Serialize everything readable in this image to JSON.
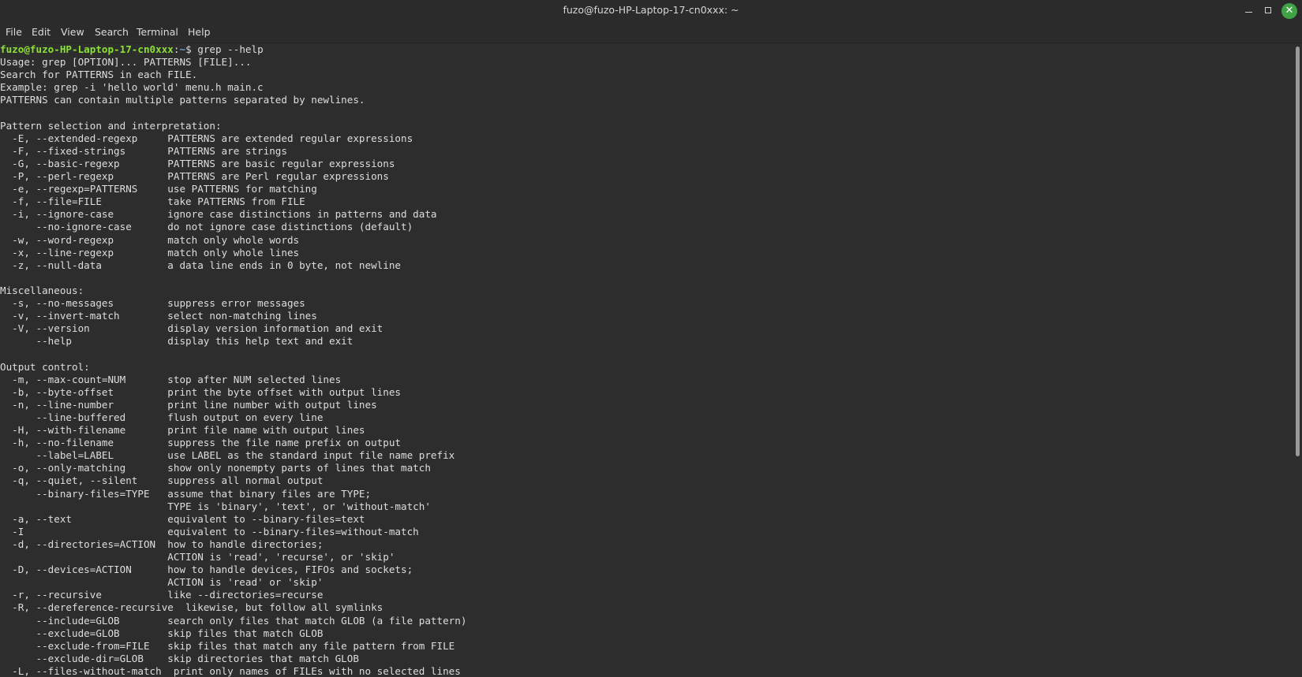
{
  "window": {
    "title": "fuzo@fuzo-HP-Laptop-17-cn0xxx: ~"
  },
  "menubar": {
    "items": [
      "File",
      "Edit",
      "View",
      "Search",
      "Terminal",
      "Help"
    ]
  },
  "terminal": {
    "prompt": {
      "user_host": "fuzo@fuzo-HP-Laptop-17-cn0xxx",
      "separator": ":",
      "path": "~",
      "symbol": "$ ",
      "command": "grep --help"
    },
    "lines": [
      "Usage: grep [OPTION]... PATTERNS [FILE]...",
      "Search for PATTERNS in each FILE.",
      "Example: grep -i 'hello world' menu.h main.c",
      "PATTERNS can contain multiple patterns separated by newlines.",
      "",
      "Pattern selection and interpretation:",
      "  -E, --extended-regexp     PATTERNS are extended regular expressions",
      "  -F, --fixed-strings       PATTERNS are strings",
      "  -G, --basic-regexp        PATTERNS are basic regular expressions",
      "  -P, --perl-regexp         PATTERNS are Perl regular expressions",
      "  -e, --regexp=PATTERNS     use PATTERNS for matching",
      "  -f, --file=FILE           take PATTERNS from FILE",
      "  -i, --ignore-case         ignore case distinctions in patterns and data",
      "      --no-ignore-case      do not ignore case distinctions (default)",
      "  -w, --word-regexp         match only whole words",
      "  -x, --line-regexp         match only whole lines",
      "  -z, --null-data           a data line ends in 0 byte, not newline",
      "",
      "Miscellaneous:",
      "  -s, --no-messages         suppress error messages",
      "  -v, --invert-match        select non-matching lines",
      "  -V, --version             display version information and exit",
      "      --help                display this help text and exit",
      "",
      "Output control:",
      "  -m, --max-count=NUM       stop after NUM selected lines",
      "  -b, --byte-offset         print the byte offset with output lines",
      "  -n, --line-number         print line number with output lines",
      "      --line-buffered       flush output on every line",
      "  -H, --with-filename       print file name with output lines",
      "  -h, --no-filename         suppress the file name prefix on output",
      "      --label=LABEL         use LABEL as the standard input file name prefix",
      "  -o, --only-matching       show only nonempty parts of lines that match",
      "  -q, --quiet, --silent     suppress all normal output",
      "      --binary-files=TYPE   assume that binary files are TYPE;",
      "                            TYPE is 'binary', 'text', or 'without-match'",
      "  -a, --text                equivalent to --binary-files=text",
      "  -I                        equivalent to --binary-files=without-match",
      "  -d, --directories=ACTION  how to handle directories;",
      "                            ACTION is 'read', 'recurse', or 'skip'",
      "  -D, --devices=ACTION      how to handle devices, FIFOs and sockets;",
      "                            ACTION is 'read' or 'skip'",
      "  -r, --recursive           like --directories=recurse",
      "  -R, --dereference-recursive  likewise, but follow all symlinks",
      "      --include=GLOB        search only files that match GLOB (a file pattern)",
      "      --exclude=GLOB        skip files that match GLOB",
      "      --exclude-from=FILE   skip files that match any file pattern from FILE",
      "      --exclude-dir=GLOB    skip directories that match GLOB",
      "  -L, --files-without-match  print only names of FILEs with no selected lines"
    ]
  },
  "icons": {
    "minimize": "minimize-icon",
    "maximize": "maximize-icon",
    "close": "close-icon"
  },
  "colors": {
    "background": "#2d2d2d",
    "prompt_user": "#8ae234",
    "prompt_path": "#729fcf",
    "close_button": "#3fa245"
  }
}
